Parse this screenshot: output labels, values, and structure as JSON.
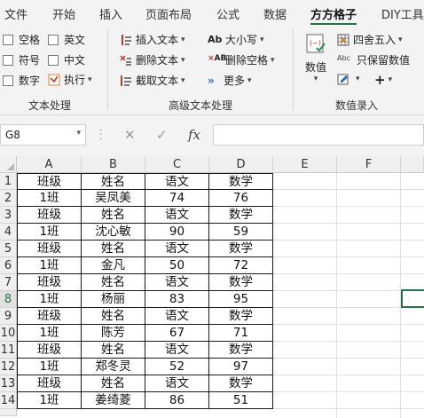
{
  "tabs": [
    "文件",
    "开始",
    "插入",
    "页面布局",
    "公式",
    "数据",
    "方方格子",
    "DIY工具"
  ],
  "active_tab": "方方格子",
  "ribbon": {
    "text_processing": {
      "checkboxes": [
        "空格",
        "英文",
        "符号",
        "中文",
        "数字"
      ],
      "execute": "执行",
      "label": "文本处理"
    },
    "advanced_text": {
      "insert_text": "插入文本",
      "delete_text": "删除文本",
      "extract_text": "截取文本",
      "case": "大小写",
      "delete_spaces": "删除空格",
      "more": "更多",
      "label": "高级文本处理"
    },
    "numeric": {
      "value_button": "数值",
      "round": "四舍五入",
      "keep_values": "只保留数值",
      "label": "数值录入"
    }
  },
  "formula_bar": {
    "name_box": "G8",
    "cancel": "✕",
    "enter": "✓",
    "fx": "fx",
    "content": ""
  },
  "columns": [
    "A",
    "B",
    "C",
    "D",
    "E",
    "F"
  ],
  "rows": [
    [
      "班级",
      "姓名",
      "语文",
      "数学"
    ],
    [
      "1班",
      "吴凤美",
      "74",
      "76"
    ],
    [
      "班级",
      "姓名",
      "语文",
      "数学"
    ],
    [
      "1班",
      "沈心敏",
      "90",
      "59"
    ],
    [
      "班级",
      "姓名",
      "语文",
      "数学"
    ],
    [
      "1班",
      "金凡",
      "50",
      "72"
    ],
    [
      "班级",
      "姓名",
      "语文",
      "数学"
    ],
    [
      "1班",
      "杨丽",
      "83",
      "95"
    ],
    [
      "班级",
      "姓名",
      "语文",
      "数学"
    ],
    [
      "1班",
      "陈芳",
      "67",
      "71"
    ],
    [
      "班级",
      "姓名",
      "语文",
      "数学"
    ],
    [
      "1班",
      "郑冬灵",
      "52",
      "97"
    ],
    [
      "班级",
      "姓名",
      "语文",
      "数学"
    ],
    [
      "1班",
      "姜绮菱",
      "86",
      "51"
    ]
  ],
  "row_numbers": [
    "1",
    "2",
    "3",
    "4",
    "5",
    "6",
    "7",
    "8",
    "9",
    "10",
    "11",
    "12",
    "13",
    "14"
  ],
  "active_row": "8",
  "colors": {
    "accent": "#217346",
    "ribbon_bg": "#f3f3f3",
    "header_bg": "#efefef"
  }
}
